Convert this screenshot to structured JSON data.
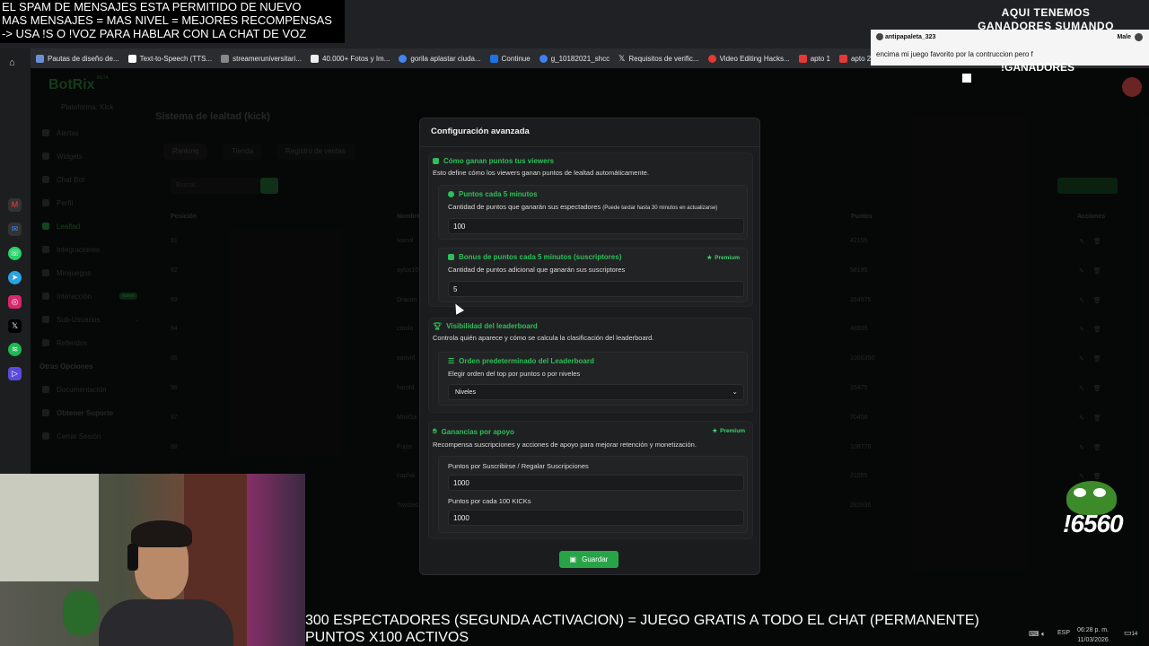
{
  "stream_overlay": {
    "top_left_lines": [
      "EL SPAM DE MENSAJES ESTA PERMITIDO DE NUEVO",
      "MAS MENSAJES = MAS NIVEL = MEJORES RECOMPENSAS",
      "-> USA !S O !VOZ PARA HABLAR CON LA CHAT DE VOZ"
    ],
    "top_right_lines": [
      "AQUI TENEMOS",
      "GANADORES SUMANDO"
    ],
    "chat": {
      "username": "antipapaleta_323",
      "tag": "Male",
      "message": "encima mi juego favorito por la contruccion pero f"
    },
    "ganadores": "!GANADORES",
    "counter": "!6560",
    "bottom_lines": [
      "300 ESPECTADORES (SEGUNDA ACTIVACION) = JUEGO GRATIS A TODO EL CHAT (PERMANENTE)",
      "PUNTOS X100 ACTIVOS"
    ]
  },
  "browser": {
    "bookmarks": [
      "Pautas de diseño de...",
      "Text-to-Speech (TTS...",
      "streameruniversitari...",
      "40.000+ Fotos y Im...",
      "gorila aplastar ciuda...",
      "Continue",
      "g_10182021_shcc",
      "Requisitos de verific...",
      "Video Editing Hacks...",
      "apto 1",
      "apto 2"
    ]
  },
  "app": {
    "logo": "BotRix",
    "logo_badge": "BETA",
    "platform": "Plataforma: Kick",
    "nav": [
      {
        "label": "Alertas",
        "active": false
      },
      {
        "label": "Widgets",
        "active": false
      },
      {
        "label": "Chat Bot",
        "active": false
      },
      {
        "label": "Perfil",
        "active": false
      },
      {
        "label": "Lealtad",
        "active": true
      },
      {
        "label": "Integraciones",
        "active": false
      },
      {
        "label": "Minijuegos",
        "active": false
      },
      {
        "label": "Interacción",
        "active": false,
        "badge": "nuevo"
      },
      {
        "label": "Sub-Usuarios",
        "active": false
      },
      {
        "label": "Referidos",
        "active": false
      }
    ],
    "nav_other_heading": "Otras Opciones",
    "nav_other": [
      "Documentación",
      "Obtener Soporte",
      "Cerrar Sesión"
    ],
    "page_title": "Sistema de lealtad (kick)",
    "tabs": [
      "Ranking",
      "Tienda",
      "Registro de ventas"
    ],
    "search_placeholder": "Buscar...",
    "table_headers": [
      "Posición",
      "Nombre",
      "Puntos",
      "Acciones"
    ],
    "rows": [
      {
        "pos": "91",
        "name": "ivanol",
        "points": "42155"
      },
      {
        "pos": "92",
        "name": "aylos10",
        "points": "58195"
      },
      {
        "pos": "93",
        "name": "Dracon",
        "points": "164975"
      },
      {
        "pos": "94",
        "name": "ctoslo",
        "points": "48935"
      },
      {
        "pos": "95",
        "name": "sanvirl",
        "points": "1000350"
      },
      {
        "pos": "96",
        "name": "harold",
        "points": "15475"
      },
      {
        "pos": "97",
        "name": "MiniGa",
        "points": "70456"
      },
      {
        "pos": "98",
        "name": "Fujos",
        "points": "108776"
      },
      {
        "pos": "99",
        "name": "caphai",
        "points": "21055"
      },
      {
        "pos": "100",
        "name": "Twisted",
        "points": "282636"
      }
    ]
  },
  "modal": {
    "title": "Configuración avanzada",
    "earn_section": {
      "heading": "Cómo ganan puntos tus viewers",
      "description": "Esto define cómo los viewers ganan puntos de lealtad automáticamente.",
      "points_card": {
        "heading": "Puntos cada 5 minutos",
        "description": "Cantidad de puntos que ganarán sus espectadores",
        "note": "(Puede tardar hasta 30 minutos en actualizarse)",
        "value": "100"
      },
      "bonus_card": {
        "heading": "Bonus de puntos cada 5 minutos (suscriptores)",
        "premium": "Premium",
        "description": "Cantidad de puntos adicional que ganarán sus suscriptores",
        "value": "5"
      }
    },
    "leaderboard_section": {
      "heading": "Visibilidad del leaderboard",
      "description": "Controla quién aparece y cómo se calcula la clasificación del leaderboard.",
      "order_card": {
        "heading": "Orden predeterminado del Leaderboard",
        "description": "Elegir orden del top por puntos o por niveles",
        "selected": "Niveles"
      }
    },
    "support_section": {
      "heading": "Ganancias por apoyo",
      "premium": "Premium",
      "description": "Recompensa suscripciones y acciones de apoyo para mejorar retención y monetización.",
      "sub_label": "Puntos por Suscribirse / Regalar Suscripciones",
      "sub_value": "1000",
      "kicks_label": "Puntos por cada 100 KICKs",
      "kicks_value": "1000"
    },
    "save_label": "Guardar"
  },
  "taskbar": {
    "lang": "ESP",
    "time": "06:28 p. m.",
    "date": "11/03/2026",
    "notifications": "14"
  }
}
